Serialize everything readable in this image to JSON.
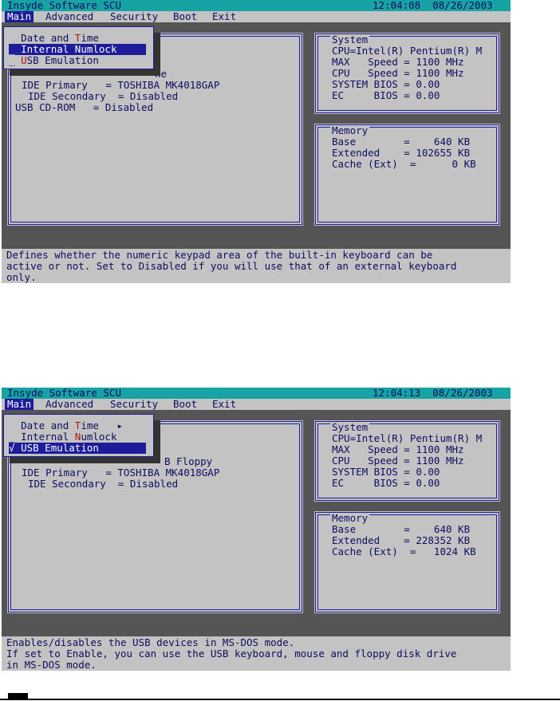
{
  "screens": [
    {
      "app_title": "Insyde Software SCU",
      "clock": "12:04:08  08/26/2003",
      "menu": [
        "Main",
        "Advanced",
        "Security",
        "Boot",
        "Exit"
      ],
      "active_menu": "Main",
      "dropdown": {
        "items": [
          {
            "prefix": "  ",
            "pre": "Date and ",
            "hot": "T",
            "post": "ime",
            "suffix": ""
          },
          {
            "prefix": "_ ",
            "pre": "Internal ",
            "hot": "N",
            "post": "umlock",
            "suffix": ""
          },
          {
            "prefix": "_ ",
            "pre": "",
            "hot": "U",
            "post": "SB Emulation",
            "suffix": ""
          }
        ],
        "selected_index": 1
      },
      "left_panel": {
        "fragment": "ne",
        "rows": [
          "IDE Primary   = TOSHIBA MK4018GAP",
          "IDE Secondary  = Disabled",
          "USB CD-ROM   = Disabled"
        ]
      },
      "system": {
        "label": "System",
        "lines": [
          "CPU=Intel(R) Pentium(R) M",
          "MAX   Speed = 1100 MHz",
          "CPU   Speed = 1100 MHz",
          "SYSTEM BIOS = 0.00",
          "EC     BIOS = 0.00"
        ]
      },
      "memory": {
        "label": "Memory",
        "lines": [
          "Base        =    640 KB",
          "Extended    = 102655 KB",
          "Cache (Ext)  =      0 KB"
        ]
      },
      "help": [
        "Defines whether the numeric keypad area of the built-in keyboard can be",
        "active or not. Set to Disabled if you will use that of an external keyboard",
        "only."
      ]
    },
    {
      "app_title": "Insyde Software SCU",
      "clock": "12:04:13  08/26/2003",
      "menu": [
        "Main",
        "Advanced",
        "Security",
        "Boot",
        "Exit"
      ],
      "active_menu": "Main",
      "dropdown": {
        "items": [
          {
            "prefix": "  ",
            "pre": "Date and ",
            "hot": "T",
            "post": "ime",
            "suffix": "   ▸"
          },
          {
            "prefix": "_ ",
            "pre": "Internal ",
            "hot": "N",
            "post": "umlock",
            "suffix": ""
          },
          {
            "prefix": "√ ",
            "pre": "",
            "hot": "U",
            "post": "SB Emulation",
            "suffix": ""
          }
        ],
        "selected_index": 2
      },
      "left_panel": {
        "fragment": "B Floppy",
        "rows": [
          "IDE Primary   = TOSHIBA MK4018GAP",
          "IDE Secondary  = Disabled"
        ]
      },
      "system": {
        "label": "System",
        "lines": [
          "CPU=Intel(R) Pentium(R) M",
          "MAX   Speed = 1100 MHz",
          "CPU   Speed = 1100 MHz",
          "SYSTEM BIOS = 0.00",
          "EC     BIOS = 0.00"
        ]
      },
      "memory": {
        "label": "Memory",
        "lines": [
          "Base        =    640 KB",
          "Extended    = 228352 KB",
          "Cache (Ext)  =   1024 KB"
        ]
      },
      "help": [
        "Enables/disables the USB devices in MS-DOS mode.",
        "If set to Enable, you can use the USB keyboard, mouse and floppy disk drive",
        "in MS-DOS mode."
      ]
    }
  ],
  "colors": {
    "title_bar": "#17a3a3",
    "screen_bg": "#555555",
    "panel_bg": "#c3c3c3",
    "highlight": "#1d1d9c",
    "hotkey": "#b01515"
  }
}
